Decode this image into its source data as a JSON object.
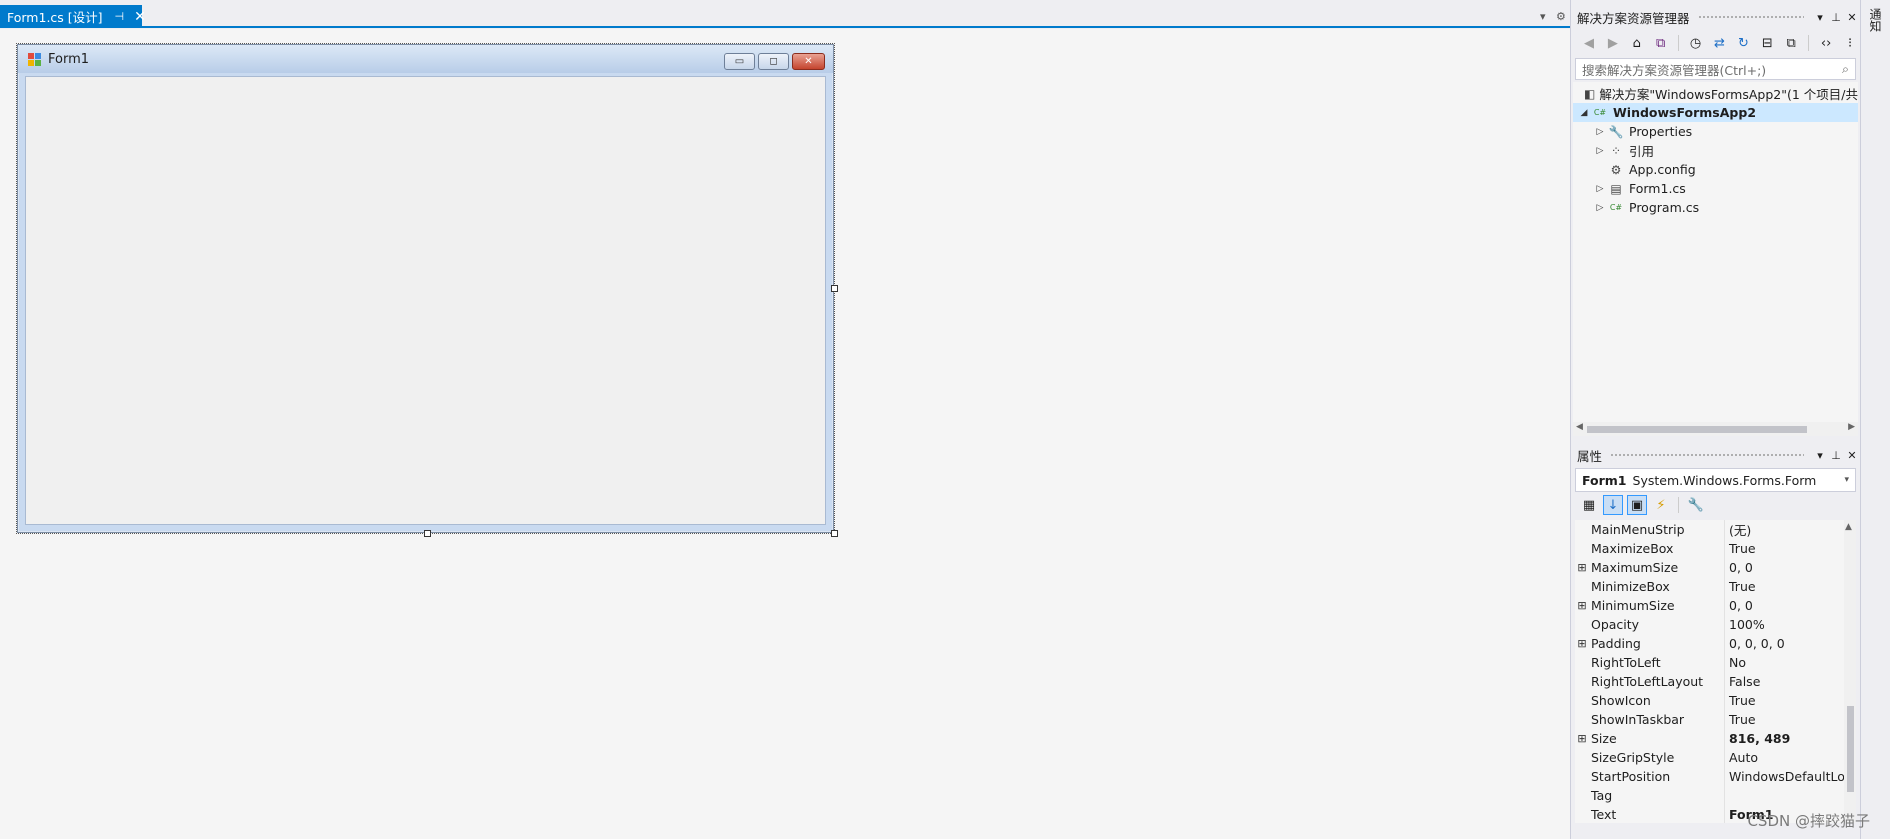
{
  "tabstrip": {
    "tab_label": "Form1.cs [设计]",
    "pin_glyph": "⊣",
    "close_glyph": "✕",
    "overflow_glyph": "▾",
    "settings_glyph": "⚙"
  },
  "form": {
    "title": "Form1",
    "minimize_glyph": "▭",
    "maximize_glyph": "◻",
    "close_glyph": "✕"
  },
  "solution_explorer": {
    "title": "解决方案资源管理器",
    "dropdown_glyph": "▾",
    "pin_glyph": "⊥",
    "close_glyph": "✕",
    "search_placeholder": "搜索解决方案资源管理器(Ctrl+;)",
    "search_glyph": "⌕",
    "toolbar": {
      "back": "◀",
      "forward": "▶",
      "home": "⌂",
      "vs": "⧉",
      "history": "◷",
      "sync": "⇄",
      "refresh": "↻",
      "collapse": "⊟",
      "copy": "⧉",
      "code": "‹›",
      "more": "⁝"
    },
    "tree": [
      {
        "label": "解决方案\"WindowsFormsApp2\"(1 个项目/共",
        "arrow": "",
        "icon": "◧",
        "bold": false,
        "indent": 0
      },
      {
        "label": "WindowsFormsApp2",
        "arrow": "◢",
        "icon": "C#",
        "bold": true,
        "indent": 0
      },
      {
        "label": "Properties",
        "arrow": "▷",
        "icon": "🔧",
        "bold": false,
        "indent": 1
      },
      {
        "label": "引用",
        "arrow": "▷",
        "icon": "⁘",
        "bold": false,
        "indent": 1
      },
      {
        "label": "App.config",
        "arrow": "",
        "icon": "⚙",
        "bold": false,
        "indent": 1
      },
      {
        "label": "Form1.cs",
        "arrow": "▷",
        "icon": "▤",
        "bold": false,
        "indent": 1
      },
      {
        "label": "Program.cs",
        "arrow": "▷",
        "icon": "C#",
        "bold": false,
        "indent": 1
      }
    ]
  },
  "properties": {
    "title": "属性",
    "dropdown_glyph": "▾",
    "pin_glyph": "⊥",
    "close_glyph": "✕",
    "object_name": "Form1",
    "object_type": "System.Windows.Forms.Form",
    "object_dd": "▾",
    "toolbar": {
      "categorized": "▦",
      "alphabetical": "↓",
      "properties": "▣",
      "events": "⚡",
      "pages": "🔧"
    },
    "rows": [
      {
        "name": "MainMenuStrip",
        "value": "(无)",
        "expandable": false,
        "bold": false
      },
      {
        "name": "MaximizeBox",
        "value": "True",
        "expandable": false,
        "bold": false
      },
      {
        "name": "MaximumSize",
        "value": "0, 0",
        "expandable": true,
        "bold": false
      },
      {
        "name": "MinimizeBox",
        "value": "True",
        "expandable": false,
        "bold": false
      },
      {
        "name": "MinimumSize",
        "value": "0, 0",
        "expandable": true,
        "bold": false
      },
      {
        "name": "Opacity",
        "value": "100%",
        "expandable": false,
        "bold": false
      },
      {
        "name": "Padding",
        "value": "0, 0, 0, 0",
        "expandable": true,
        "bold": false
      },
      {
        "name": "RightToLeft",
        "value": "No",
        "expandable": false,
        "bold": false
      },
      {
        "name": "RightToLeftLayout",
        "value": "False",
        "expandable": false,
        "bold": false
      },
      {
        "name": "ShowIcon",
        "value": "True",
        "expandable": false,
        "bold": false
      },
      {
        "name": "ShowInTaskbar",
        "value": "True",
        "expandable": false,
        "bold": false
      },
      {
        "name": "Size",
        "value": "816, 489",
        "expandable": true,
        "bold": true
      },
      {
        "name": "SizeGripStyle",
        "value": "Auto",
        "expandable": false,
        "bold": false
      },
      {
        "name": "StartPosition",
        "value": "WindowsDefaultLocati",
        "expandable": false,
        "bold": false
      },
      {
        "name": "Tag",
        "value": "",
        "expandable": false,
        "bold": false
      },
      {
        "name": "Text",
        "value": "Form1",
        "expandable": false,
        "bold": true
      }
    ],
    "expand_glyph": "⊞",
    "scroll_up": "▲"
  },
  "side_strip": {
    "tab_label": "通知"
  },
  "watermark": "CSDN @摔跤猫子",
  "colors": {
    "accent": "#007acc",
    "selection": "#cce8ff"
  }
}
